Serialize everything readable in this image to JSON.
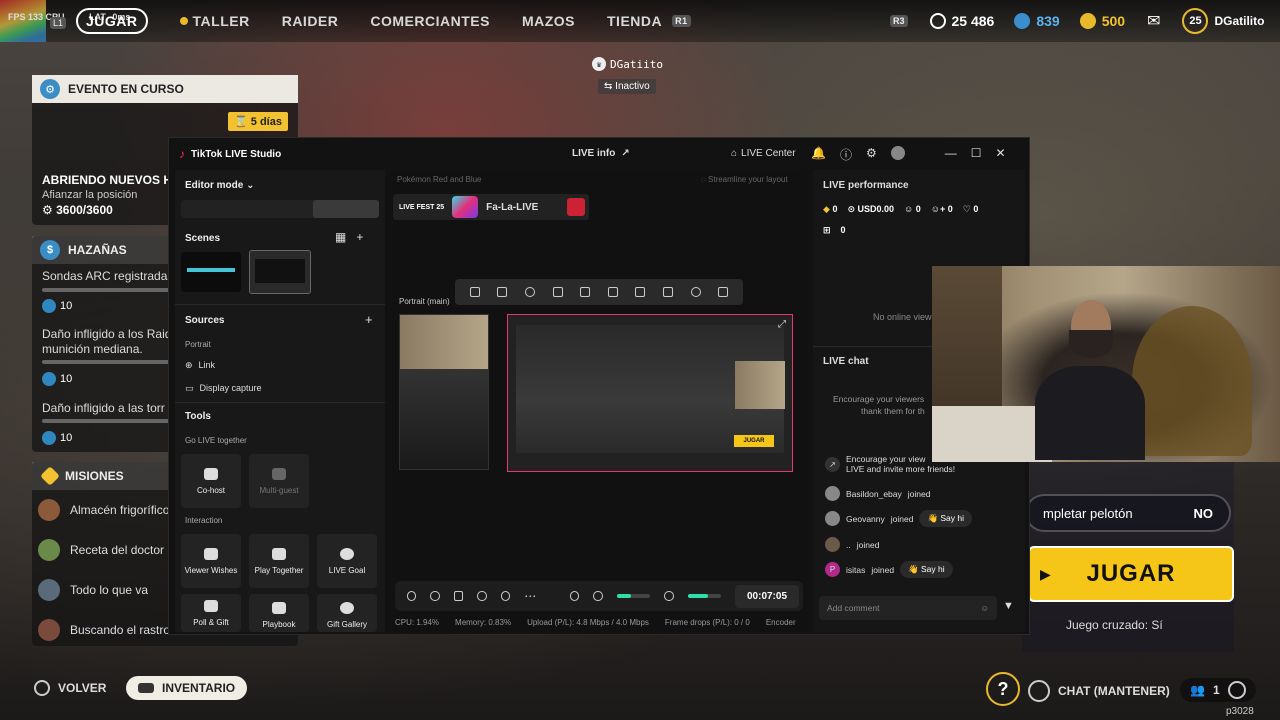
{
  "hud": {
    "fps": "FPS 133",
    "cpu": "CPU",
    "lat": "LAT",
    "ms": "0ms"
  },
  "nav": {
    "badge_left": "L1",
    "tabs": [
      "JUGAR",
      "TALLER",
      "RAIDER",
      "COMERCIANTES",
      "MAZOS",
      "TIENDA"
    ],
    "badge_right": "R1"
  },
  "currency": {
    "r3": "R3",
    "credits": "25 486",
    "tokens": "839",
    "gold": "500",
    "level": "25",
    "username": "DGatilito"
  },
  "player_tag": {
    "name": "DGatiito",
    "status": "Inactivo"
  },
  "event": {
    "header": "EVENTO EN CURSO",
    "days": "5 días",
    "title": "ABRIENDO NUEVOS HOR",
    "subtitle": "Afianzar la posición",
    "progress": "3600/3600"
  },
  "feats": {
    "header": "HAZAÑAS",
    "items": [
      {
        "text": "Sondas ARC registradas",
        "reward": "10"
      },
      {
        "text": "Daño infligido a los Raid",
        "text2": "munición mediana.",
        "reward": "10"
      },
      {
        "text": "Daño infligido a las torr",
        "reward": "10"
      }
    ]
  },
  "missions": {
    "header": "MISIONES",
    "items": [
      "Almacén frigorífico",
      "Receta del doctor",
      "Todo lo que va",
      "Buscando el rastro"
    ]
  },
  "tiktok": {
    "app_title": "TikTok LIVE Studio",
    "live_info": "LIVE info",
    "live_center": "LIVE Center",
    "editor_mode": "Editor mode",
    "scenes": "Scenes",
    "sources": "Sources",
    "portrait": "Portrait",
    "link": "Link",
    "display_capture": "Display capture",
    "tools": "Tools",
    "go_live_together": "Go LIVE together",
    "cohost": "Co-host",
    "multiguest": "Multi-guest",
    "interaction": "Interaction",
    "viewer_wishes": "Viewer Wishes",
    "play_together": "Play Together",
    "live_goal": "LIVE Goal",
    "poll_gift": "Poll & Gift",
    "playbook": "Playbook",
    "gift_gallery": "Gift Gallery",
    "banner_hint": "Pokémon Red and Blue",
    "streamline_hint": "Streamline your layout",
    "livefest": "LIVE FEST 25",
    "fala": "Fa-La-LIVE",
    "portrait_main": "Portrait (main)",
    "timer": "00:07:05",
    "status": {
      "cpu": "CPU: 1.94%",
      "memory": "Memory: 0.83%",
      "upload": "Upload (P/L): 4.8 Mbps / 4.0 Mbps",
      "frames": "Frame drops (P/L): 0 / 0",
      "encoder": "Encoder"
    },
    "perf_title": "LIVE performance",
    "perf": {
      "diamonds": "0",
      "usd": "USD0.00",
      "users": "0",
      "follows": "0",
      "likes": "0",
      "gifts": "0"
    },
    "no_viewers": "No online view",
    "chat_title": "LIVE chat",
    "encourage": "Encourage your viewers",
    "encourage2": "thank them for th",
    "invite": "Encourage your view",
    "invite2": "LIVE and invite more friends!",
    "chat": [
      {
        "user": "Basildon_ebay",
        "action": "joined",
        "sayhi": false
      },
      {
        "user": "Geovanny",
        "action": "joined",
        "sayhi": true
      },
      {
        "user": "..",
        "action": "joined",
        "sayhi": false
      },
      {
        "user": "isitas",
        "action": "joined",
        "sayhi": true
      }
    ],
    "say_hi": "Say hi",
    "add_comment": "Add comment"
  },
  "lobby": {
    "squad_fill": "mpletar pelotón",
    "squad_value": "NO",
    "play": "JUGAR",
    "crossplay": "Juego cruzado: Sí"
  },
  "bottom": {
    "back": "VOLVER",
    "inventory": "INVENTARIO",
    "chat": "CHAT (MANTENER)",
    "party": "1",
    "id": "p3028"
  }
}
